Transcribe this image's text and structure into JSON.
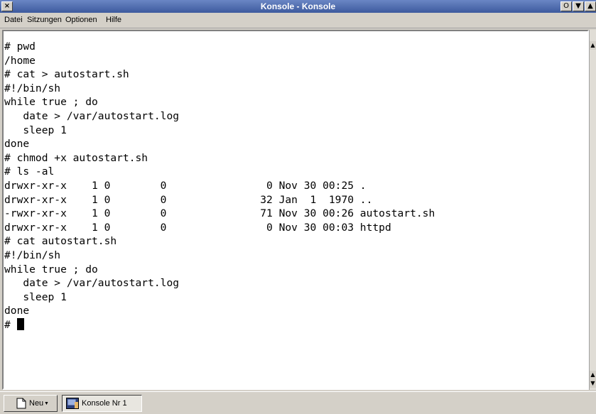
{
  "window": {
    "title": "Konsole - Konsole",
    "close_symbol": "×",
    "restore_symbol": "O",
    "shade_symbol": "▼",
    "maximize_symbol": "▲"
  },
  "menu": [
    {
      "label": "Datei"
    },
    {
      "label": "Sitzungen"
    },
    {
      "label": "Optionen"
    },
    {
      "label": "Hilfe"
    }
  ],
  "terminal": {
    "lines": [
      "# pwd",
      "/home",
      "# cat > autostart.sh",
      "#!/bin/sh",
      "while true ; do",
      "   date > /var/autostart.log",
      "   sleep 1",
      "done",
      "# chmod +x autostart.sh",
      "# ls -al",
      "drwxr-xr-x    1 0        0                0 Nov 30 00:25 .",
      "drwxr-xr-x    1 0        0               32 Jan  1  1970 ..",
      "-rwxr-xr-x    1 0        0               71 Nov 30 00:26 autostart.sh",
      "drwxr-xr-x    1 0        0                0 Nov 30 00:03 httpd",
      "# cat autostart.sh",
      "#!/bin/sh",
      "while true ; do",
      "   date > /var/autostart.log",
      "   sleep 1",
      "done"
    ],
    "prompt": "# ",
    "scroll_up_symbol": "▲",
    "scroll_down_symbol": "▼"
  },
  "taskbar": {
    "new_label": "Neu",
    "session_label": "Konsole Nr 1"
  },
  "colors": {
    "titlebar": "#3d5a9e",
    "chrome": "#d4d0c8",
    "terminal_bg": "#ffffff",
    "terminal_fg": "#000000"
  }
}
